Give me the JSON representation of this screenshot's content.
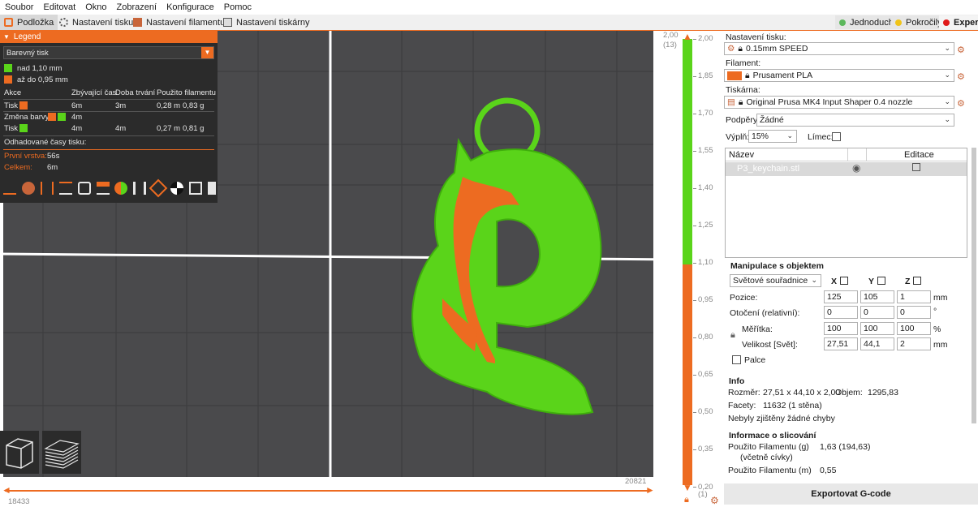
{
  "menu": [
    "Soubor",
    "Editovat",
    "Okno",
    "Zobrazení",
    "Konfigurace",
    "Pomoc"
  ],
  "tabs": {
    "plater": "Podložka",
    "print_settings": "Nastavení tisku",
    "filament_settings": "Nastavení filamentu",
    "printer_settings": "Nastavení tiskárny"
  },
  "modes": {
    "simple": "Jednoduchý",
    "advanced": "Pokročilý",
    "expert": "Expert"
  },
  "colors": {
    "accent": "#ed6b21",
    "green": "#5ad41a",
    "simple": "#5cb85c",
    "advanced": "#f0c419",
    "expert": "#e01a1a"
  },
  "legend": {
    "title": "Legend",
    "view_type": "Barevný tisk",
    "ranges": [
      {
        "label": "nad 1,10 mm",
        "color": "#5ad41a"
      },
      {
        "label": "až do 0,95 mm",
        "color": "#ed6b21"
      }
    ],
    "headers": {
      "action": "Akce",
      "remaining": "Zbývající čas",
      "duration": "Doba trvání",
      "used": "Použito filamentu"
    },
    "rows": [
      {
        "action": "Tisk",
        "remaining": "6m",
        "duration": "3m",
        "len": "0,28 m",
        "weight": "0,83 g"
      },
      {
        "action": "Změna barvy",
        "remaining": "4m",
        "duration": "",
        "len": "",
        "weight": ""
      },
      {
        "action": "Tisk",
        "remaining": "4m",
        "duration": "4m",
        "len": "0,27 m",
        "weight": "0,81 g"
      }
    ],
    "estimated_label": "Odhadované časy tisku:",
    "first_layer_label": "První vrstva:",
    "first_layer_value": "56s",
    "total_label": "Celkem:",
    "total_value": "6m"
  },
  "hslider": {
    "left": "18433",
    "right": "20821"
  },
  "vslider": {
    "top_value": "2,00",
    "top_layer": "(13)",
    "bottom_value": "0,20",
    "bottom_layer": "(1)",
    "ticks": [
      "2,00",
      "1,85",
      "1,70",
      "1,55",
      "1,40",
      "1,25",
      "1,10",
      "0,95",
      "0,80",
      "0,65",
      "0,50",
      "0,35",
      "0,20"
    ],
    "color_change_at": "1,10"
  },
  "panel": {
    "print_settings_label": "Nastavení tisku:",
    "print_profile": "0.15mm SPEED",
    "filament_label": "Filament:",
    "filament_profile": "Prusament PLA",
    "filament_color": "#ed6b21",
    "printer_label": "Tiskárna:",
    "printer_profile": "Original Prusa MK4 Input Shaper 0.4 nozzle",
    "supports_label": "Podpěry:",
    "supports_value": "Žádné",
    "infill_label": "Výplň:",
    "infill_value": "15%",
    "brim_label": "Límec:",
    "objects_col_name": "Název",
    "objects_col_edit": "Editace",
    "object_name": "P3_keychain.stl"
  },
  "manipulation": {
    "title": "Manipulace s objektem",
    "coord_system": "Světové souřadnice",
    "axes": [
      "X",
      "Y",
      "Z"
    ],
    "position_label": "Pozice:",
    "position": [
      "125",
      "105",
      "1"
    ],
    "rotation_label": "Otočení (relativní):",
    "rotation": [
      "0",
      "0",
      "0"
    ],
    "scale_label": "Měřítka:",
    "scale": [
      "100",
      "100",
      "100"
    ],
    "size_label": "Velikost [Svět]:",
    "size": [
      "27,51",
      "44,1",
      "2"
    ],
    "unit_mm": "mm",
    "unit_deg": "°",
    "unit_pct": "%",
    "inches_label": "Palce"
  },
  "info": {
    "title": "Info",
    "size_label": "Rozměr:",
    "size_value": "27,51 x 44,10 x 2,00",
    "volume_label": "Objem:",
    "volume_value": "1295,83",
    "facets_label": "Facety:",
    "facets_value": "11632 (1 stěna)",
    "errors": "Nebyly zjištěny žádné chyby"
  },
  "slice_info": {
    "title": "Informace o slicování",
    "used_g_label": "Použito Filamentu (g)",
    "used_g_sub": "(včetně cívky)",
    "used_g_value": "1,63 (194,63)",
    "used_m_label": "Použito Filamentu (m)",
    "used_m_value": "0,55"
  },
  "export_label": "Exportovat G-code"
}
